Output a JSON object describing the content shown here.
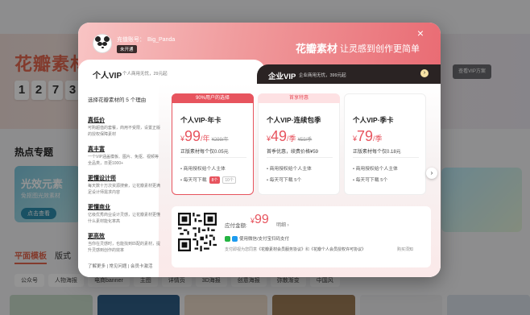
{
  "background": {
    "site_title": "花瓣素材",
    "counter_digits": [
      "1",
      "2",
      "7",
      "3"
    ],
    "vip_button": "查看VIP方案",
    "section_title": "热点专题",
    "promo_card": {
      "title": "光效元素",
      "subtitle": "免抠图光效素材",
      "button": "点击查看"
    },
    "tabs": [
      "平面模板",
      "版式"
    ],
    "chips": [
      "公众号",
      "人物海报",
      "电商banner",
      "主图",
      "详情页",
      "3D海报",
      "创意海报",
      "弥散渐变",
      "中国风"
    ]
  },
  "header": {
    "account_label": "充值账号：",
    "account_name": "Big_Panda",
    "status_badge": "未开通",
    "brand": "花瓣素材",
    "slogan": "让灵感到创作更简单",
    "close": "×"
  },
  "tabs": {
    "personal": {
      "title": "个人VIP",
      "desc": "个人商用无忧，29元起"
    },
    "enterprise": {
      "title": "企业VIP",
      "desc": "企业商用无忧，399元起"
    }
  },
  "reasons": {
    "title": "选择花瓣素材的 5 个理由",
    "items": [
      {
        "heading": "真低价",
        "text": "可购超值的套餐，商用不受限，设置正版的授权保障素材"
      },
      {
        "heading": "真丰富",
        "text": "一个VIP涵盖模板、图片、免抠、视频等全品类，日更1000+"
      },
      {
        "heading": "更懂设计师",
        "text": "每天数十万次资源搜索，让花瓣素材更满足设计师需求内容"
      },
      {
        "heading": "更懂商业",
        "text": "亿级优秀商业设计灵感，让花瓣素材更懂什么素材能化率高"
      },
      {
        "heading": "更高效",
        "text": "当你在灵感时，也能找到匹配的素材，提升灵感到创作的效率"
      }
    ],
    "footer": "了解更多 | 常见问题 | 会员卡激活"
  },
  "plans": [
    {
      "ribbon": "90%用户的选择",
      "name": "个人VIP·年卡",
      "currency": "¥",
      "price": "99",
      "unit": "/年",
      "old_price": "¥299/年",
      "desc": "正版素材每个仅0.05元",
      "feature1": "• 商用授权给个人主体",
      "feature2": "• 每天可下载",
      "downloads": "8个",
      "downloads_alt": "10个"
    },
    {
      "ribbon": "首享特惠",
      "name": "个人VIP·连续包季",
      "currency": "¥",
      "price": "49",
      "unit": "/季",
      "old_price": "¥59/季",
      "desc": "首季优惠，续费价格¥59",
      "feature1": "• 商用授权给个人主体",
      "feature2": "• 每天可下载 5个",
      "downloads": "",
      "downloads_alt": ""
    },
    {
      "ribbon": "",
      "name": "个人VIP·季卡",
      "currency": "¥",
      "price": "79",
      "unit": "/季",
      "old_price": "",
      "desc": "正版素材每个仅0.18元",
      "feature1": "• 商用授权给个人主体",
      "feature2": "• 每天可下载 5个",
      "downloads": "",
      "downloads_alt": ""
    }
  ],
  "payment": {
    "amount_label": "应付金额:",
    "currency": "¥",
    "amount": "99",
    "detail": "明细 ›",
    "methods": "使用微信/支付宝扫码支付",
    "agree_prefix": "支付即视为您同意",
    "agree_link1": "《花瓣素材会员服务协议》",
    "agree_mid": "和",
    "agree_link2": "《花瓣个人会员授权许可协议》",
    "help": "购买须知"
  },
  "colors": {
    "accent": "#e7545e",
    "header_start": "#f8c4c4",
    "header_end": "#e96b73",
    "enterprise_bg": "#2a2323"
  }
}
